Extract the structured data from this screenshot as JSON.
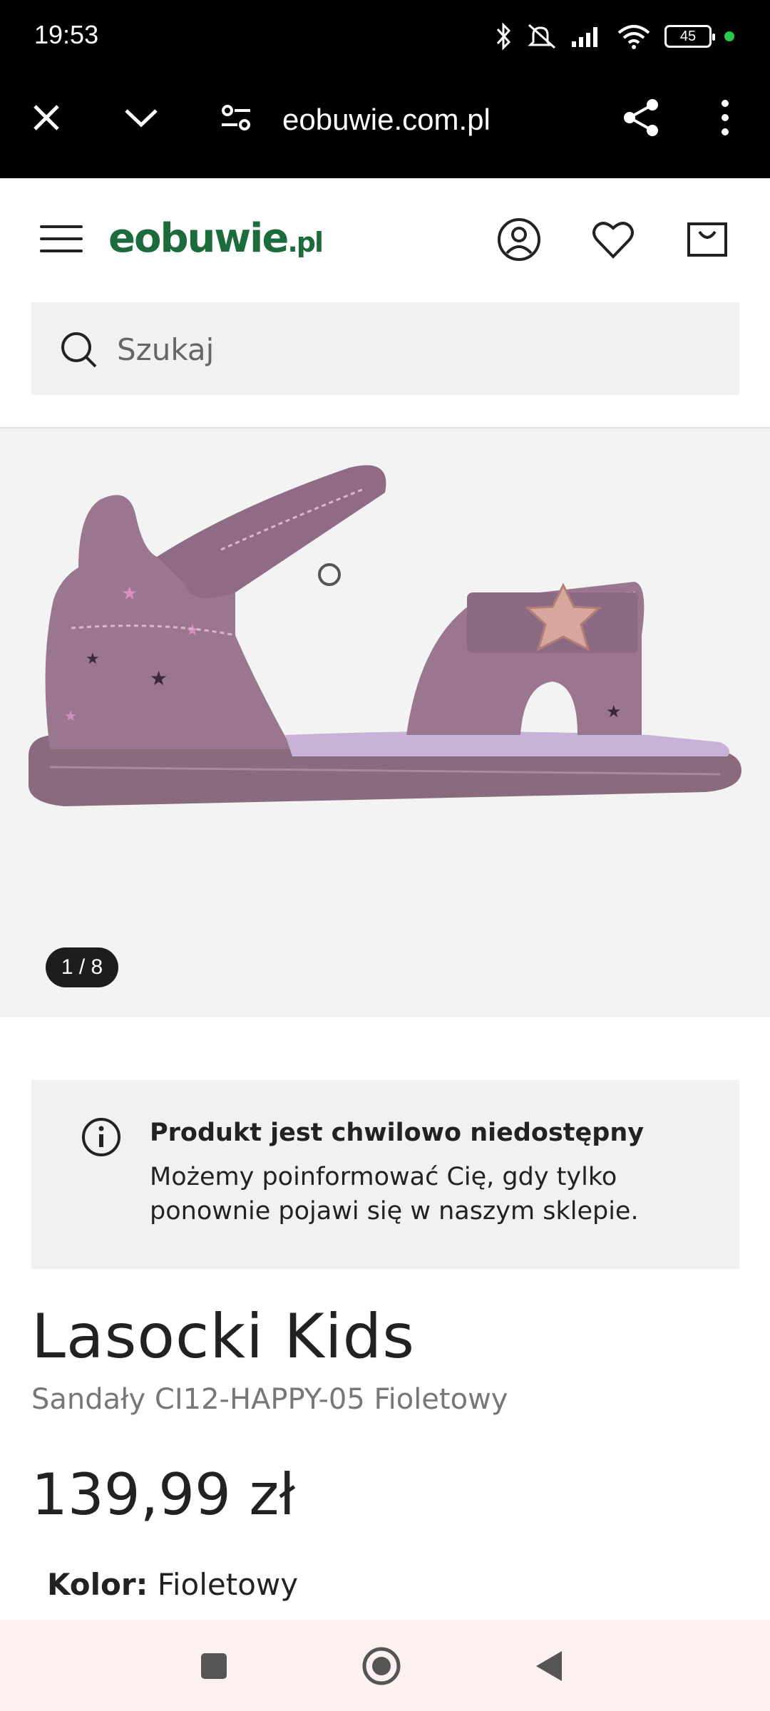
{
  "status_bar": {
    "time": "19:53",
    "battery": "45"
  },
  "browser": {
    "url": "eobuwie.com.pl"
  },
  "header": {
    "logo_main": "eobuwie",
    "logo_suffix": ".pl"
  },
  "search": {
    "placeholder": "Szukaj"
  },
  "gallery": {
    "counter": "1 / 8"
  },
  "notice": {
    "title": "Produkt jest chwilowo niedostępny",
    "text": "Możemy poinformować Cię, gdy tylko ponownie pojawi się w naszym sklepie."
  },
  "product": {
    "brand": "Lasocki Kids",
    "name": "Sandały CI12-HAPPY-05 Fioletowy",
    "price": "139,99 zł",
    "color_label": "Kolor:",
    "color_value": "Fioletowy"
  },
  "colors": {
    "brand_green": "#1c6b3c",
    "notice_bg": "#f1f1f1",
    "gallery_bg": "#f3f3f3",
    "shoe_purple": "#9a7690"
  }
}
